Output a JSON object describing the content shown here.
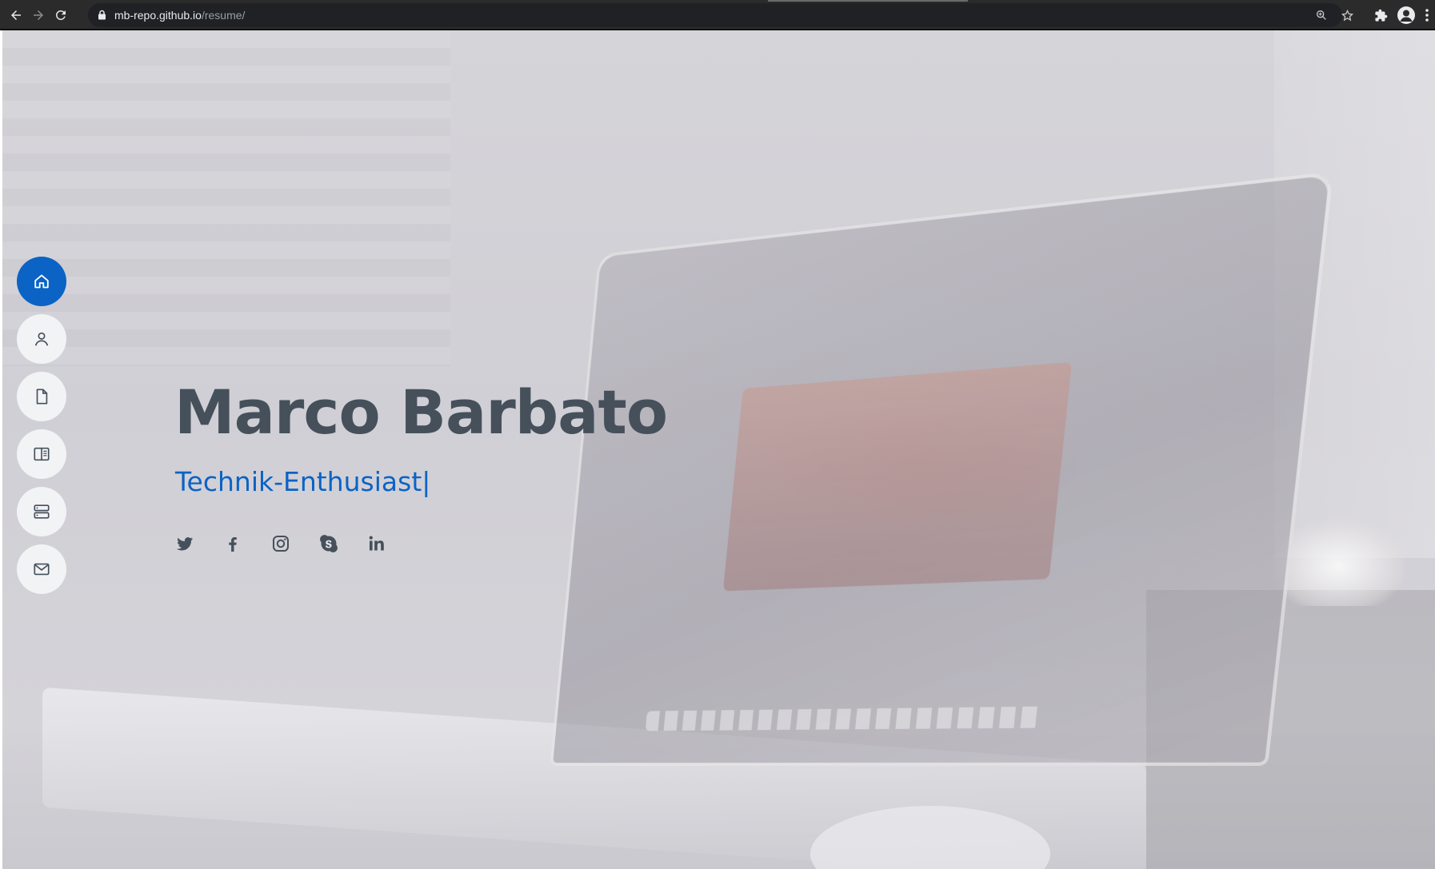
{
  "browser": {
    "url_host": "mb-repo.github.io",
    "url_path": "/resume/"
  },
  "hero": {
    "name": "Marco Barbato",
    "role": "Technik-Enthusiast",
    "cursor": "|"
  },
  "side_nav": {
    "items": [
      {
        "icon": "home-icon",
        "active": true
      },
      {
        "icon": "person-icon",
        "active": false
      },
      {
        "icon": "file-icon",
        "active": false
      },
      {
        "icon": "book-icon",
        "active": false
      },
      {
        "icon": "server-icon",
        "active": false
      },
      {
        "icon": "envelope-icon",
        "active": false
      }
    ]
  },
  "social": {
    "items": [
      {
        "icon": "twitter-icon"
      },
      {
        "icon": "facebook-icon"
      },
      {
        "icon": "instagram-icon"
      },
      {
        "icon": "skype-icon"
      },
      {
        "icon": "linkedin-icon"
      }
    ]
  },
  "colors": {
    "accent": "#0b63c5",
    "heading": "#45505b",
    "nav_bg": "#f2f3f5",
    "chrome_bg": "#2b2b2b"
  }
}
